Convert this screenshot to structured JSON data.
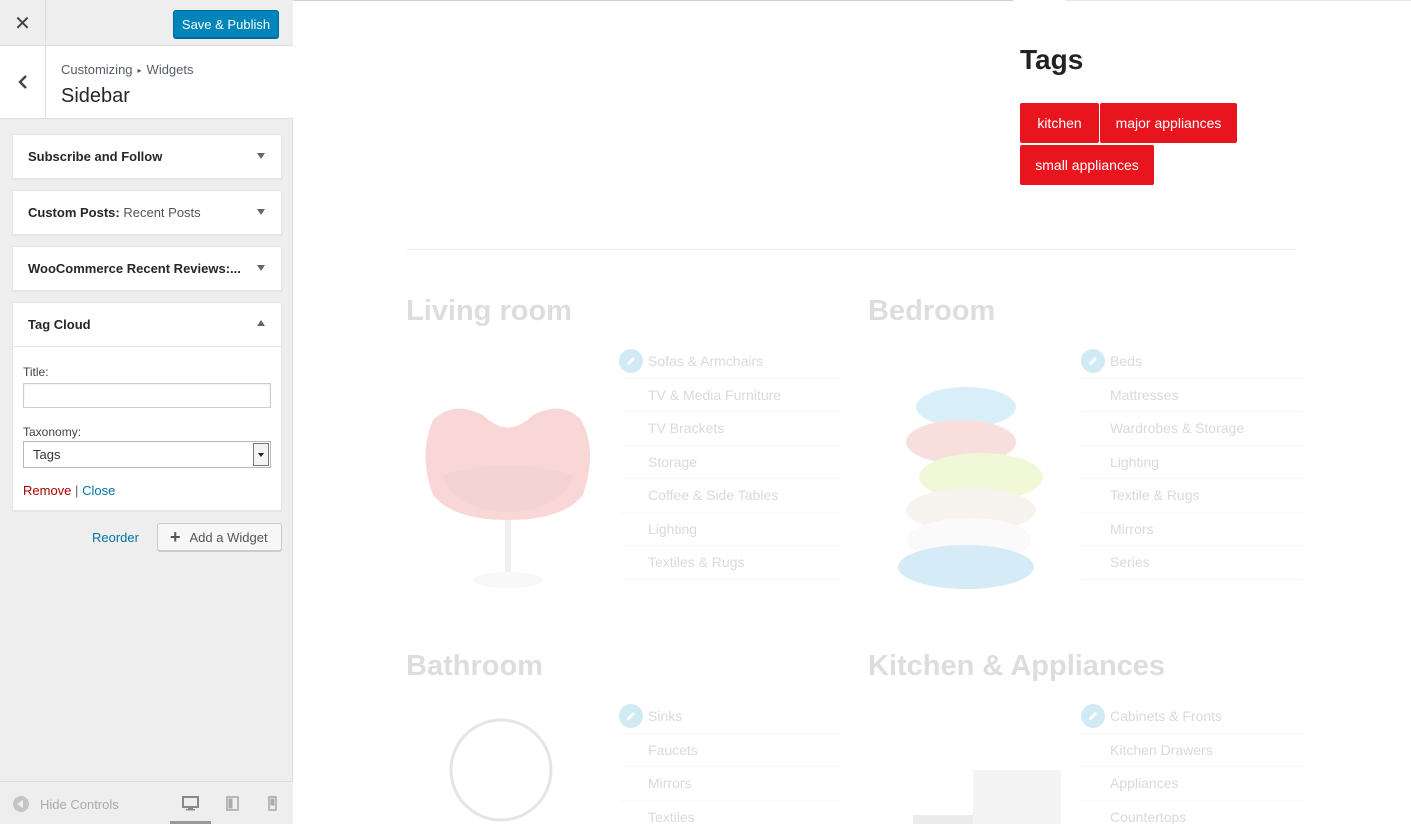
{
  "topbar": {
    "close_glyph": "✕",
    "save_label": "Save & Publish"
  },
  "section": {
    "breadcrumb_root": "Customizing",
    "breadcrumb_sep": "▸",
    "breadcrumb_current": "Widgets",
    "title": "Sidebar"
  },
  "widgets": [
    {
      "title": "Subscribe and Follow",
      "in_title": ""
    },
    {
      "title": "Custom Posts:",
      "in_title": " Recent Posts"
    },
    {
      "title": "WooCommerce Recent Reviews:...",
      "in_title": ""
    },
    {
      "title": "Tag Cloud",
      "in_title": ""
    }
  ],
  "tag_cloud_form": {
    "title_label": "Title:",
    "title_value": "",
    "taxonomy_label": "Taxonomy:",
    "taxonomy_value": "Tags",
    "remove_label": "Remove",
    "separator": "|",
    "close_label": "Close"
  },
  "actions": {
    "reorder_label": "Reorder",
    "add_widget_label": "Add a Widget"
  },
  "footer": {
    "hide_controls_label": "Hide Controls",
    "devices": [
      "desktop-icon",
      "tablet-icon",
      "mobile-icon"
    ]
  },
  "preview": {
    "tags_heading": "Tags",
    "tags": [
      "kitchen",
      "major appliances",
      "small appliances"
    ],
    "tag_color": "#e8151f",
    "categories": [
      {
        "title": "Living room",
        "items": [
          "Sofas & Armchairs",
          "TV & Media Furniture",
          "TV Brackets",
          "Storage",
          "Coffee & Side Tables",
          "Lighting",
          "Textiles & Rugs"
        ]
      },
      {
        "title": "Bedroom",
        "items": [
          "Beds",
          "Mattresses",
          "Wardrobes & Storage",
          "Lighting",
          "Textile & Rugs",
          "Mirrors",
          "Series"
        ]
      },
      {
        "title": "Bathroom",
        "items": [
          "Sinks",
          "Faucets",
          "Mirrors",
          "Textiles"
        ]
      },
      {
        "title": "Kitchen & Appliances",
        "items": [
          "Cabinets & Fronts",
          "Kitchen Drawers",
          "Appliances",
          "Countertops"
        ]
      }
    ]
  }
}
